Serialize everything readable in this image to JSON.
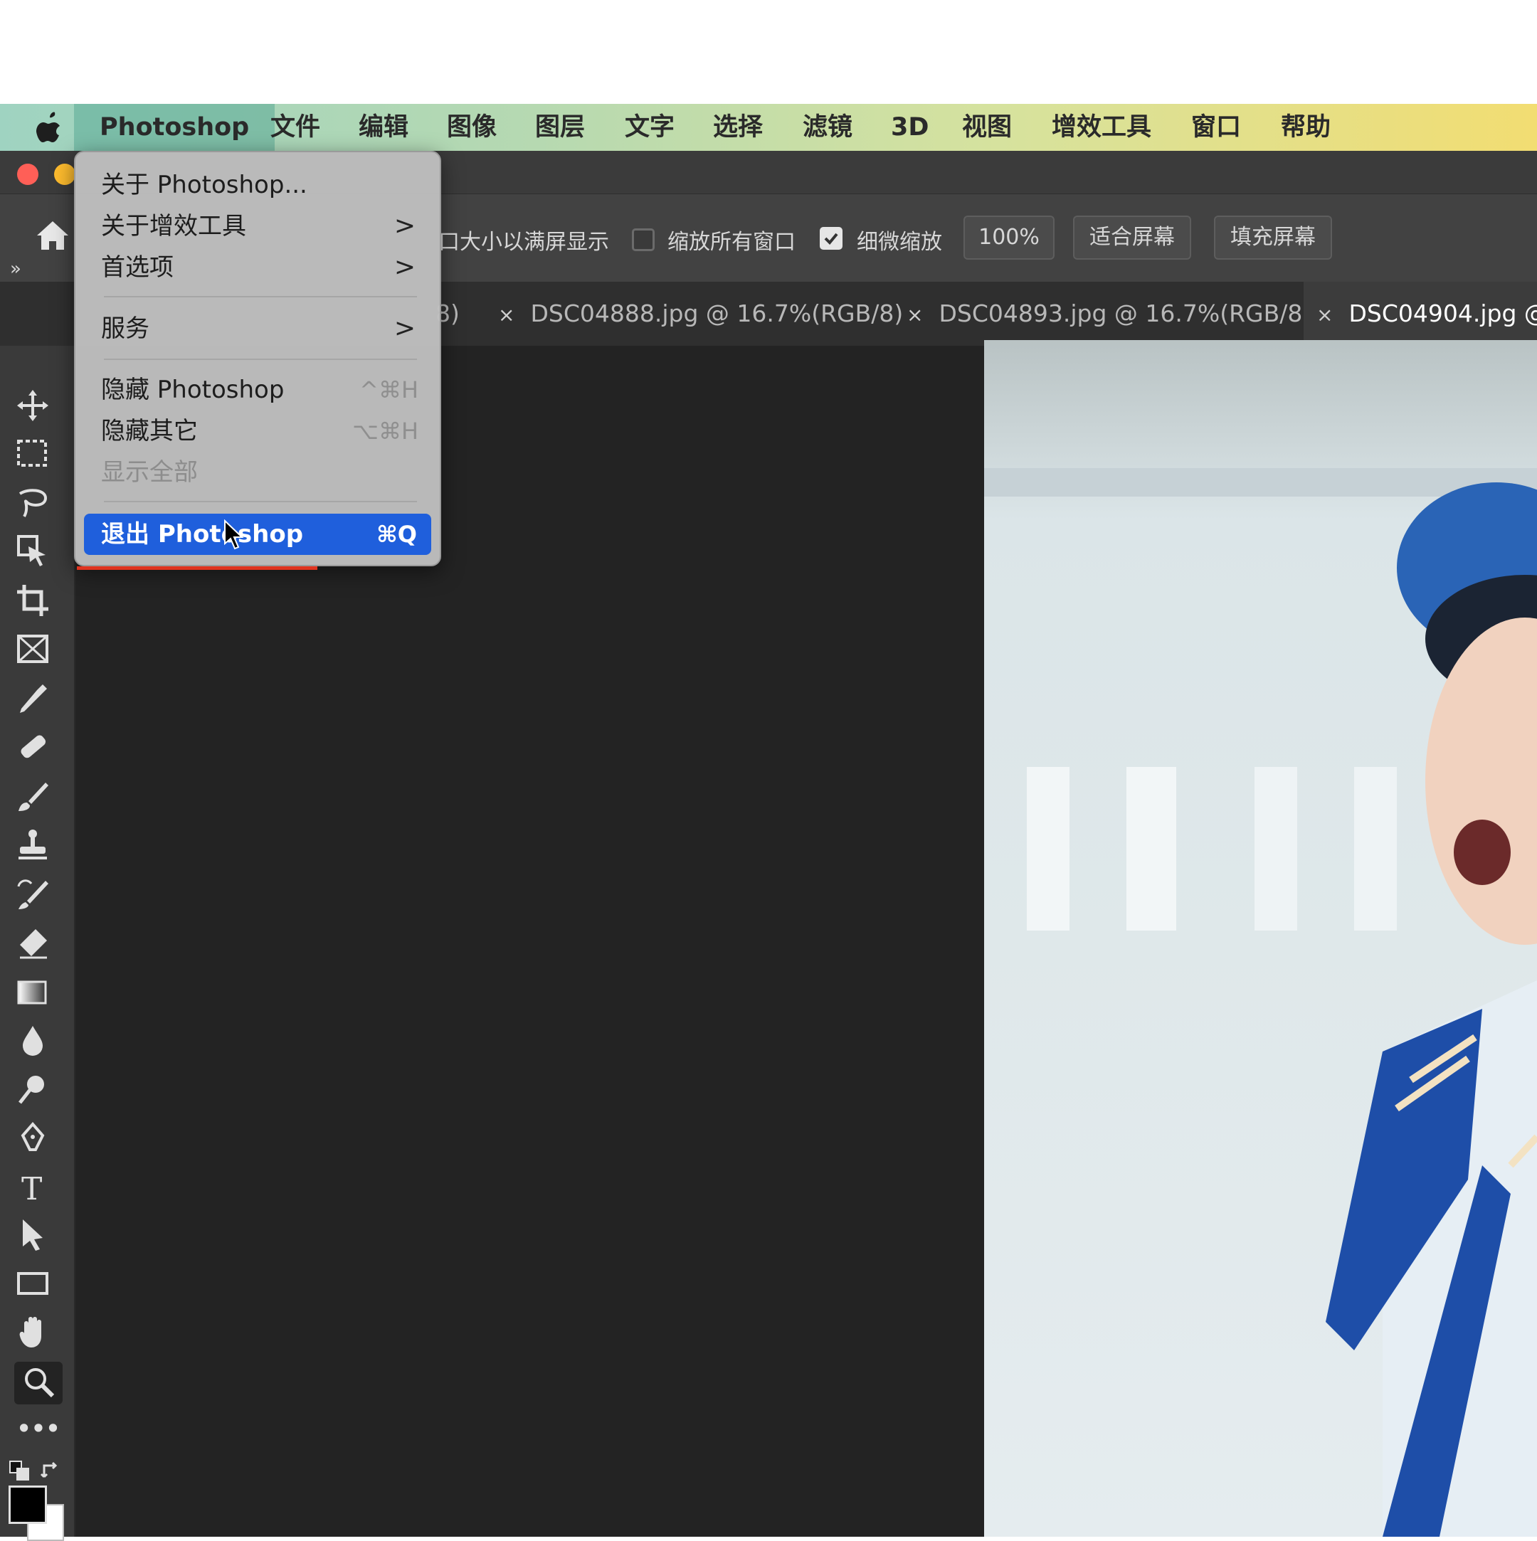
{
  "menubar": {
    "items": [
      "Photoshop",
      "文件",
      "编辑",
      "图像",
      "图层",
      "文字",
      "选择",
      "滤镜",
      "3D",
      "视图",
      "增效工具",
      "窗口",
      "帮助"
    ]
  },
  "options_bar": {
    "resize_label": "口大小以满屏显示",
    "zoom_all_label": "缩放所有窗口",
    "zoom_all_checked": false,
    "scrubby_label": "细微缩放",
    "scrubby_checked": true,
    "zoom_value": "100%",
    "fit_screen": "适合屏幕",
    "fill_screen": "填充屏幕",
    "panel_toggle": "»"
  },
  "tabs": [
    {
      "label": "8)",
      "close": "×",
      "active": false
    },
    {
      "label": "DSC04888.jpg @ 16.7%(RGB/8)",
      "close": "×",
      "active": false
    },
    {
      "label": "DSC04893.jpg @ 16.7%(RGB/8)",
      "close": "×",
      "active": false
    },
    {
      "label": "DSC04904.jpg @",
      "close": "×",
      "active": true
    }
  ],
  "toolbar": {
    "tools": [
      "move-tool",
      "marquee-tool",
      "lasso-tool",
      "object-select-tool",
      "crop-tool",
      "frame-tool",
      "eyedropper-tool",
      "healing-tool",
      "brush-tool",
      "stamp-tool",
      "history-brush-tool",
      "eraser-tool",
      "gradient-tool",
      "blur-tool",
      "dodge-tool",
      "pen-tool",
      "type-tool",
      "path-select-tool",
      "rectangle-tool",
      "hand-tool",
      "zoom-tool",
      "more-tools"
    ],
    "selected": "zoom-tool",
    "type_glyph": "T",
    "more_glyph": "•••"
  },
  "photoshop_menu": {
    "items": [
      {
        "label": "关于 Photoshop...",
        "shortcut": "",
        "submenu": false,
        "disabled": false
      },
      {
        "label": "关于增效工具",
        "shortcut": "",
        "submenu": true,
        "disabled": false
      },
      {
        "label": "首选项",
        "shortcut": "",
        "submenu": true,
        "disabled": false
      },
      {
        "label": "服务",
        "shortcut": "",
        "submenu": true,
        "disabled": false
      },
      {
        "label": "隐藏 Photoshop",
        "shortcut": "^⌘H",
        "submenu": false,
        "disabled": false
      },
      {
        "label": "隐藏其它",
        "shortcut": "⌥⌘H",
        "submenu": false,
        "disabled": false
      },
      {
        "label": "显示全部",
        "shortcut": "",
        "submenu": false,
        "disabled": true
      },
      {
        "label": "退出 Photoshop",
        "shortcut": "⌘Q",
        "submenu": false,
        "disabled": false,
        "highlighted": true
      }
    ],
    "submenu_arrow": ">"
  },
  "colors": {
    "menu_highlight": "#1f5fdc",
    "annotation_underline": "#e0331f",
    "close_button": "#ff5f57",
    "minimize_button": "#febc2e"
  }
}
